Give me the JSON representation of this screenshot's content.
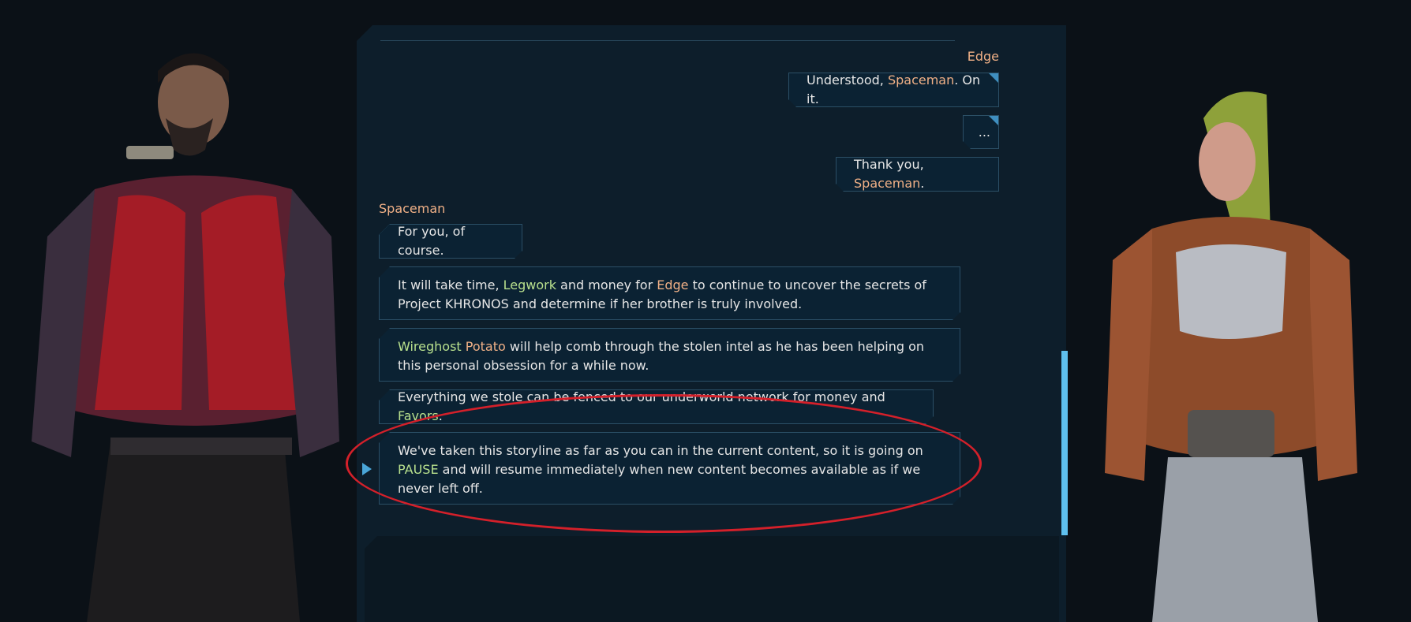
{
  "dialog": {
    "speakers": {
      "edge": "Edge",
      "spaceman": "Spaceman"
    },
    "edge_lines": [
      {
        "pre": "Understood, ",
        "name": "Spaceman",
        "post": ". On it."
      },
      {
        "text": "..."
      },
      {
        "pre": "Thank you, ",
        "name": "Spaceman",
        "post": "."
      }
    ],
    "spaceman_lines": [
      {
        "text": "For you, of course."
      },
      {
        "a": "It will take time, ",
        "b": "Legwork",
        "c": " and money for ",
        "d": "Edge",
        "e": " to continue to uncover the secrets of Project KHRONOS and determine if her brother is truly involved."
      },
      {
        "a": "Wireghost",
        "b": " ",
        "c": "Potato",
        "d": " will help comb through the stolen intel as he has been helping on this personal obsession for a while now."
      },
      {
        "a": "Everything we stole can be fenced to our underworld network for money and ",
        "b": "Favors",
        "c": "."
      },
      {
        "a": "We've taken this storyline as far as you can in the current content, so it is going on ",
        "b": "PAUSE",
        "c": " and will resume immediately when new content becomes available as if we never left off."
      }
    ]
  },
  "colors": {
    "panel": "#0d1e2b",
    "bubble": "#0b2233",
    "name_highlight": "#f0b086",
    "keyword_highlight": "#b8e08d",
    "scrollbar": "#5fc0ee",
    "annotation": "#d4202a"
  },
  "icons": {
    "active_choice": "triangle-right-icon"
  }
}
